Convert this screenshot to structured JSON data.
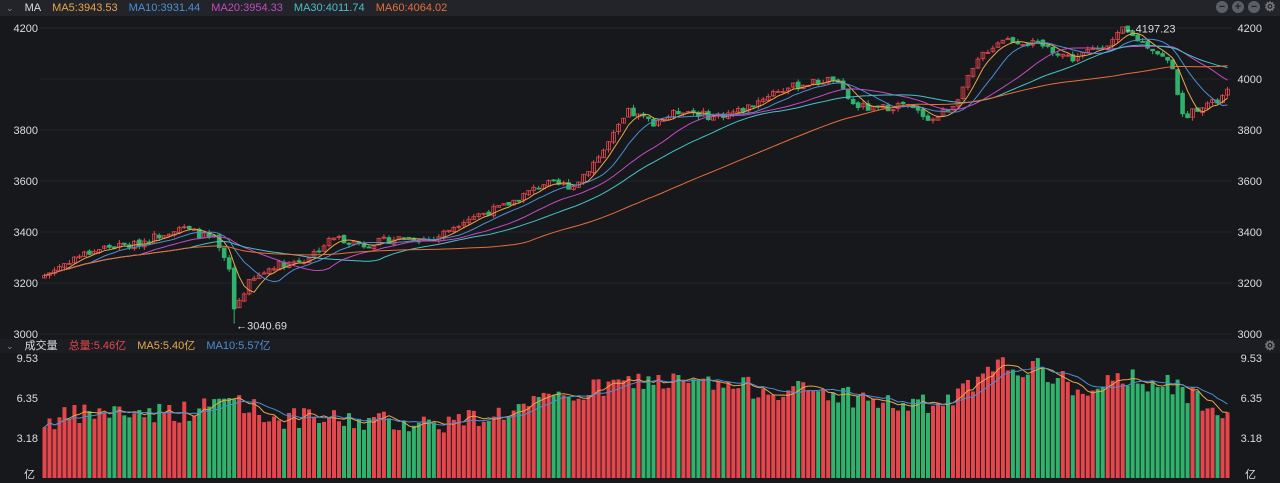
{
  "header": {
    "indicator": "MA",
    "ma5": "MA5:3943.53",
    "ma10": "MA10:3931.44",
    "ma20": "MA20:3954.33",
    "ma30": "MA30:4011.74",
    "ma60": "MA60:4064.02"
  },
  "volume_header": {
    "title": "成交量",
    "total": "总量:5.46亿",
    "ma5": "MA5:5.40亿",
    "ma10": "MA10:5.57亿"
  },
  "icons": {
    "zoom_out": "minus-circle-icon",
    "zoom_in": "plus-circle-icon",
    "reset": "minus-circle-icon",
    "settings": "gear-icon"
  },
  "colors": {
    "up": "#e5464b",
    "down": "#2fb36c",
    "ma5": "#e8a64a",
    "ma10": "#4a8fd6",
    "ma20": "#c44bc4",
    "ma30": "#45c2c8",
    "ma60": "#e66f3a"
  },
  "chart_data": [
    {
      "type": "candlestick",
      "title": "MA",
      "ylim": [
        3000,
        4200
      ],
      "yticks": [
        "4200",
        "4000",
        "3800",
        "3600",
        "3400",
        "3200",
        "3000"
      ],
      "left_yticks": [
        "4200",
        "",
        "3800",
        "3600",
        "3400",
        "3200",
        "3000"
      ],
      "candle_count": 238,
      "close_waypoints": [
        [
          0,
          3230
        ],
        [
          6,
          3300
        ],
        [
          12,
          3340
        ],
        [
          18,
          3350
        ],
        [
          27,
          3420
        ],
        [
          34,
          3370
        ],
        [
          37,
          3250
        ],
        [
          38,
          3100
        ],
        [
          41,
          3200
        ],
        [
          46,
          3270
        ],
        [
          52,
          3290
        ],
        [
          58,
          3380
        ],
        [
          64,
          3350
        ],
        [
          72,
          3380
        ],
        [
          78,
          3370
        ],
        [
          84,
          3450
        ],
        [
          92,
          3500
        ],
        [
          100,
          3590
        ],
        [
          106,
          3580
        ],
        [
          112,
          3720
        ],
        [
          117,
          3870
        ],
        [
          122,
          3830
        ],
        [
          128,
          3880
        ],
        [
          134,
          3850
        ],
        [
          140,
          3880
        ],
        [
          146,
          3950
        ],
        [
          152,
          3980
        ],
        [
          158,
          4000
        ],
        [
          162,
          3900
        ],
        [
          166,
          3880
        ],
        [
          172,
          3900
        ],
        [
          178,
          3840
        ],
        [
          182,
          3900
        ],
        [
          188,
          4100
        ],
        [
          192,
          4160
        ],
        [
          200,
          4130
        ],
        [
          206,
          4080
        ],
        [
          214,
          4150
        ],
        [
          216,
          4190
        ],
        [
          222,
          4120
        ],
        [
          226,
          4050
        ],
        [
          228,
          3850
        ],
        [
          232,
          3900
        ],
        [
          235,
          3910
        ],
        [
          237,
          3950
        ]
      ],
      "annotations": [
        {
          "label": "←4197.23",
          "type": "high",
          "value": 4197.23
        },
        {
          "label": "←3040.69",
          "type": "low",
          "value": 3040.69
        }
      ],
      "moving_averages": [
        "MA5",
        "MA10",
        "MA20",
        "MA30",
        "MA60"
      ]
    },
    {
      "type": "bar",
      "title": "成交量",
      "unit": "亿",
      "ylim": [
        0,
        9.53
      ],
      "yticks": [
        "9.53",
        "6.35",
        "3.18",
        "亿"
      ],
      "volume_waypoints": [
        [
          0,
          4.5
        ],
        [
          10,
          5.2
        ],
        [
          30,
          5.3
        ],
        [
          38,
          6.5
        ],
        [
          45,
          4.8
        ],
        [
          60,
          4.6
        ],
        [
          80,
          4.4
        ],
        [
          92,
          5.2
        ],
        [
          104,
          6.4
        ],
        [
          112,
          7.2
        ],
        [
          120,
          7.8
        ],
        [
          140,
          7.2
        ],
        [
          158,
          6.8
        ],
        [
          170,
          5.8
        ],
        [
          180,
          5.8
        ],
        [
          188,
          7.8
        ],
        [
          192,
          9.0
        ],
        [
          200,
          8.6
        ],
        [
          210,
          6.4
        ],
        [
          216,
          8.2
        ],
        [
          224,
          7.5
        ],
        [
          237,
          5.46
        ]
      ]
    }
  ]
}
